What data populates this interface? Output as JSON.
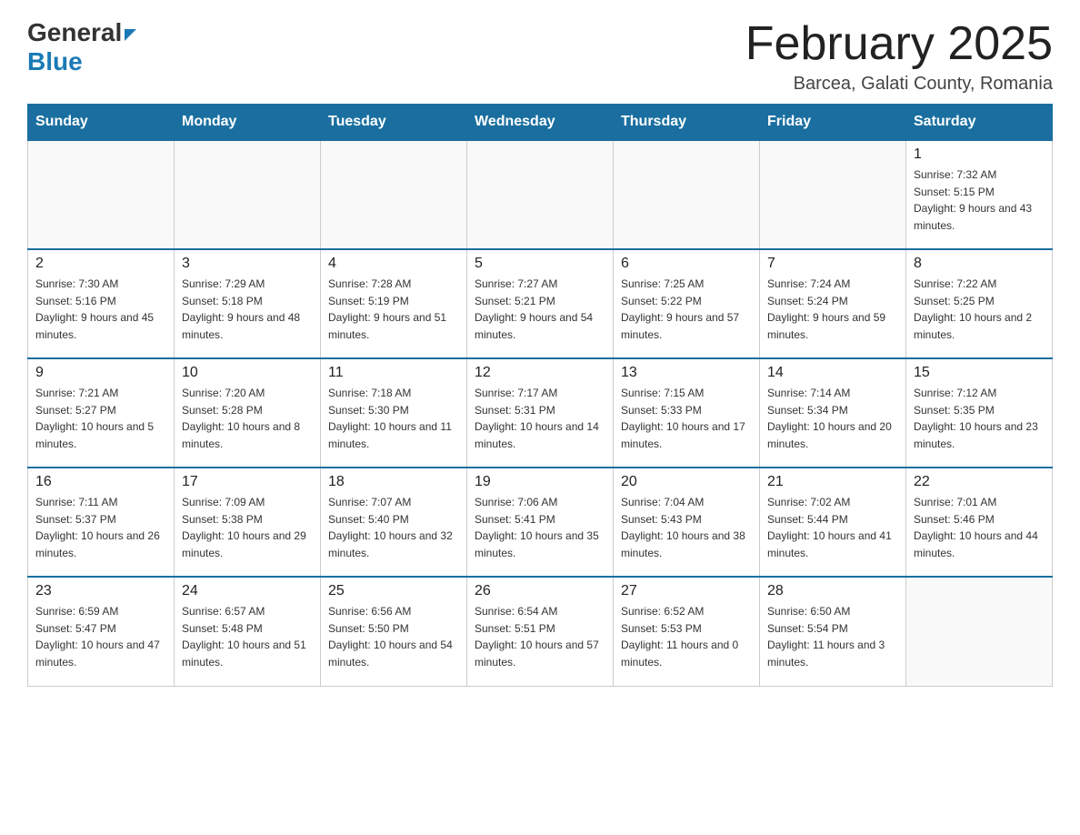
{
  "logo": {
    "general": "General",
    "blue": "Blue"
  },
  "title": "February 2025",
  "subtitle": "Barcea, Galati County, Romania",
  "days_of_week": [
    "Sunday",
    "Monday",
    "Tuesday",
    "Wednesday",
    "Thursday",
    "Friday",
    "Saturday"
  ],
  "weeks": [
    [
      {
        "day": "",
        "info": ""
      },
      {
        "day": "",
        "info": ""
      },
      {
        "day": "",
        "info": ""
      },
      {
        "day": "",
        "info": ""
      },
      {
        "day": "",
        "info": ""
      },
      {
        "day": "",
        "info": ""
      },
      {
        "day": "1",
        "info": "Sunrise: 7:32 AM\nSunset: 5:15 PM\nDaylight: 9 hours and 43 minutes."
      }
    ],
    [
      {
        "day": "2",
        "info": "Sunrise: 7:30 AM\nSunset: 5:16 PM\nDaylight: 9 hours and 45 minutes."
      },
      {
        "day": "3",
        "info": "Sunrise: 7:29 AM\nSunset: 5:18 PM\nDaylight: 9 hours and 48 minutes."
      },
      {
        "day": "4",
        "info": "Sunrise: 7:28 AM\nSunset: 5:19 PM\nDaylight: 9 hours and 51 minutes."
      },
      {
        "day": "5",
        "info": "Sunrise: 7:27 AM\nSunset: 5:21 PM\nDaylight: 9 hours and 54 minutes."
      },
      {
        "day": "6",
        "info": "Sunrise: 7:25 AM\nSunset: 5:22 PM\nDaylight: 9 hours and 57 minutes."
      },
      {
        "day": "7",
        "info": "Sunrise: 7:24 AM\nSunset: 5:24 PM\nDaylight: 9 hours and 59 minutes."
      },
      {
        "day": "8",
        "info": "Sunrise: 7:22 AM\nSunset: 5:25 PM\nDaylight: 10 hours and 2 minutes."
      }
    ],
    [
      {
        "day": "9",
        "info": "Sunrise: 7:21 AM\nSunset: 5:27 PM\nDaylight: 10 hours and 5 minutes."
      },
      {
        "day": "10",
        "info": "Sunrise: 7:20 AM\nSunset: 5:28 PM\nDaylight: 10 hours and 8 minutes."
      },
      {
        "day": "11",
        "info": "Sunrise: 7:18 AM\nSunset: 5:30 PM\nDaylight: 10 hours and 11 minutes."
      },
      {
        "day": "12",
        "info": "Sunrise: 7:17 AM\nSunset: 5:31 PM\nDaylight: 10 hours and 14 minutes."
      },
      {
        "day": "13",
        "info": "Sunrise: 7:15 AM\nSunset: 5:33 PM\nDaylight: 10 hours and 17 minutes."
      },
      {
        "day": "14",
        "info": "Sunrise: 7:14 AM\nSunset: 5:34 PM\nDaylight: 10 hours and 20 minutes."
      },
      {
        "day": "15",
        "info": "Sunrise: 7:12 AM\nSunset: 5:35 PM\nDaylight: 10 hours and 23 minutes."
      }
    ],
    [
      {
        "day": "16",
        "info": "Sunrise: 7:11 AM\nSunset: 5:37 PM\nDaylight: 10 hours and 26 minutes."
      },
      {
        "day": "17",
        "info": "Sunrise: 7:09 AM\nSunset: 5:38 PM\nDaylight: 10 hours and 29 minutes."
      },
      {
        "day": "18",
        "info": "Sunrise: 7:07 AM\nSunset: 5:40 PM\nDaylight: 10 hours and 32 minutes."
      },
      {
        "day": "19",
        "info": "Sunrise: 7:06 AM\nSunset: 5:41 PM\nDaylight: 10 hours and 35 minutes."
      },
      {
        "day": "20",
        "info": "Sunrise: 7:04 AM\nSunset: 5:43 PM\nDaylight: 10 hours and 38 minutes."
      },
      {
        "day": "21",
        "info": "Sunrise: 7:02 AM\nSunset: 5:44 PM\nDaylight: 10 hours and 41 minutes."
      },
      {
        "day": "22",
        "info": "Sunrise: 7:01 AM\nSunset: 5:46 PM\nDaylight: 10 hours and 44 minutes."
      }
    ],
    [
      {
        "day": "23",
        "info": "Sunrise: 6:59 AM\nSunset: 5:47 PM\nDaylight: 10 hours and 47 minutes."
      },
      {
        "day": "24",
        "info": "Sunrise: 6:57 AM\nSunset: 5:48 PM\nDaylight: 10 hours and 51 minutes."
      },
      {
        "day": "25",
        "info": "Sunrise: 6:56 AM\nSunset: 5:50 PM\nDaylight: 10 hours and 54 minutes."
      },
      {
        "day": "26",
        "info": "Sunrise: 6:54 AM\nSunset: 5:51 PM\nDaylight: 10 hours and 57 minutes."
      },
      {
        "day": "27",
        "info": "Sunrise: 6:52 AM\nSunset: 5:53 PM\nDaylight: 11 hours and 0 minutes."
      },
      {
        "day": "28",
        "info": "Sunrise: 6:50 AM\nSunset: 5:54 PM\nDaylight: 11 hours and 3 minutes."
      },
      {
        "day": "",
        "info": ""
      }
    ]
  ]
}
